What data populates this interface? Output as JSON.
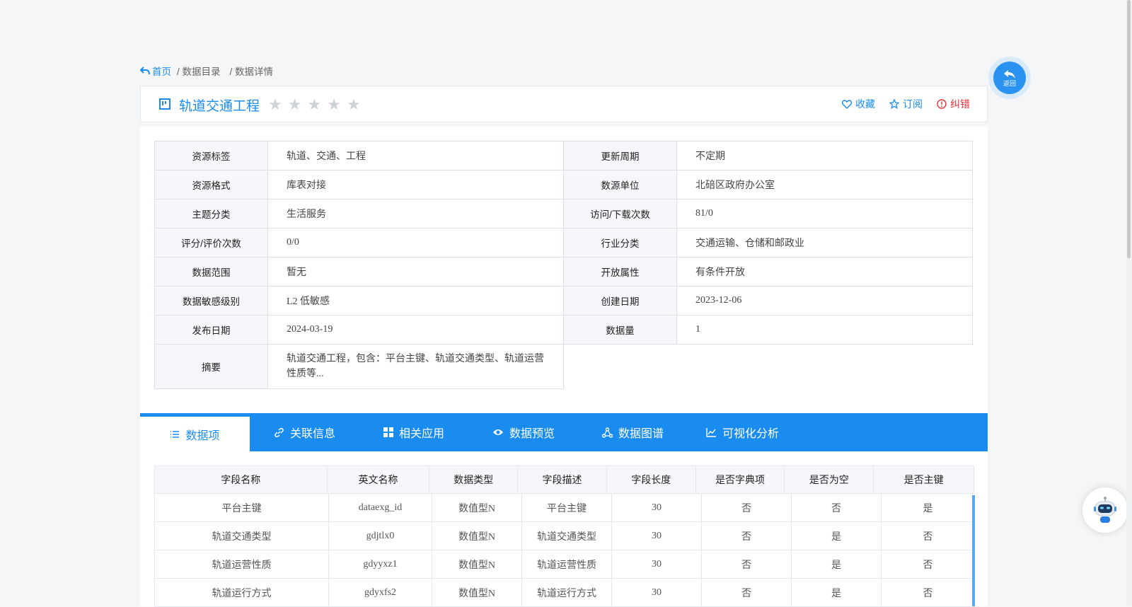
{
  "breadcrumb": {
    "home": "首页",
    "catalog": "/ 数据目录",
    "detail": "/ 数据详情"
  },
  "title": {
    "text": "轨道交通工程",
    "rating_stars": 5,
    "rating_value": 0
  },
  "actions": {
    "favorite": "收藏",
    "subscribe": "订阅",
    "report": "纠错"
  },
  "back_button": {
    "label": "返回"
  },
  "info": {
    "rows": [
      {
        "l1": "资源标签",
        "v1": "轨道、交通、工程",
        "l2": "更新周期",
        "v2": "不定期"
      },
      {
        "l1": "资源格式",
        "v1": "库表对接",
        "l2": "数源单位",
        "v2": "北碚区政府办公室"
      },
      {
        "l1": "主题分类",
        "v1": "生活服务",
        "l2": "访问/下载次数",
        "v2": "81/0"
      },
      {
        "l1": "评分/评价次数",
        "v1": "0/0",
        "l2": "行业分类",
        "v2": "交通运输、仓储和邮政业"
      },
      {
        "l1": "数据范围",
        "v1": "暂无",
        "l2": "开放属性",
        "v2": "有条件开放"
      },
      {
        "l1": "数据敏感级别",
        "v1": "L2 低敏感",
        "l2": "创建日期",
        "v2": "2023-12-06"
      },
      {
        "l1": "发布日期",
        "v1": "2024-03-19",
        "l2": "数据量",
        "v2": "1"
      }
    ],
    "summary": {
      "label": "摘要",
      "value": "轨道交通工程，包含：平台主键、轨道交通类型、轨道运营性质等..."
    }
  },
  "tabs": [
    "数据项",
    "关联信息",
    "相关应用",
    "数据预览",
    "数据图谱",
    "可视化分析"
  ],
  "grid": {
    "columns": [
      "字段名称",
      "英文名称",
      "数据类型",
      "字段描述",
      "字段长度",
      "是否字典项",
      "是否为空",
      "是否主键"
    ],
    "rows": [
      [
        "平台主键",
        "dataexg_id",
        "数值型N",
        "平台主键",
        "30",
        "否",
        "否",
        "是"
      ],
      [
        "轨道交通类型",
        "gdjtlx0",
        "数值型N",
        "轨道交通类型",
        "30",
        "否",
        "是",
        "否"
      ],
      [
        "轨道运营性质",
        "gdyyxz1",
        "数值型N",
        "轨道运营性质",
        "30",
        "否",
        "是",
        "否"
      ],
      [
        "轨道运行方式",
        "gdyxfs2",
        "数值型N",
        "轨道运行方式",
        "30",
        "否",
        "是",
        "否"
      ]
    ]
  },
  "colors": {
    "accent": "#1a8cf0",
    "error": "#e0333a",
    "star_empty": "#cfd3d8"
  },
  "icons": {
    "home": "back-arrow-icon",
    "title": "catalog-icon",
    "favorite": "heart-icon",
    "subscribe": "star-outline-icon",
    "report": "exclamation-circle-icon",
    "tabs": [
      "list-icon",
      "link-icon",
      "grid-icon",
      "eye-icon",
      "graph-icon",
      "line-chart-icon"
    ],
    "assistant": "robot-icon"
  }
}
